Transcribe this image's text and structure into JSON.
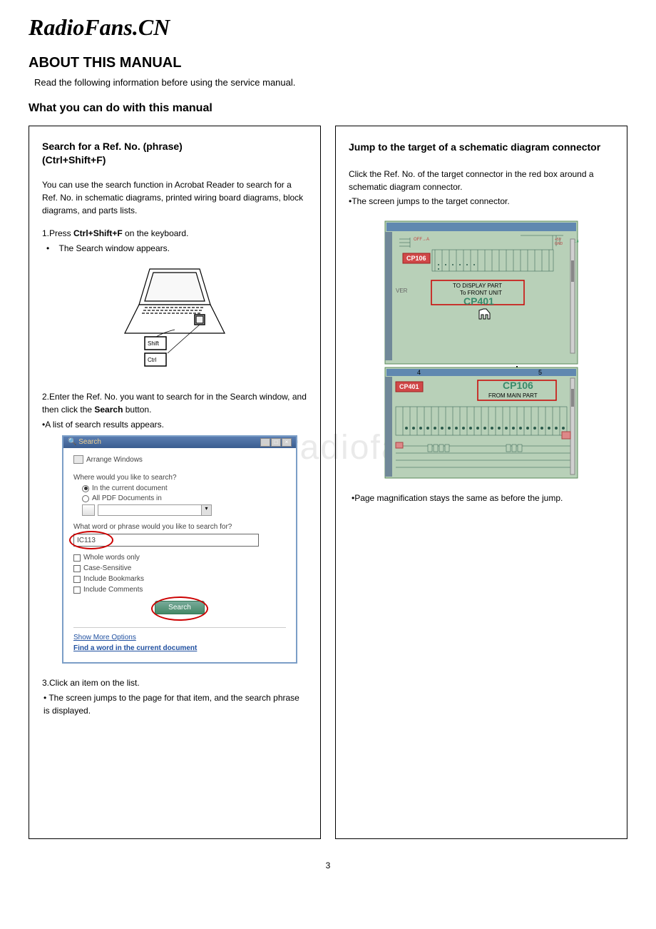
{
  "watermark": "RadioFans.CN",
  "bg_watermark": "www.radiofans.cn",
  "main_title": "ABOUT THIS MANUAL",
  "intro": "Read the following information before using the service manual.",
  "sub_heading": "What you can do with this manual",
  "left": {
    "title": "Search for a Ref. No. (phrase)",
    "subtitle": "(Ctrl+Shift+F)",
    "para1": "You can use the search function in Acrobat Reader to search for a Ref. No. in schematic diagrams, printed wiring board diagrams, block diagrams, and parts lists.",
    "step1_a": "1.Press ",
    "step1_b": "Ctrl+Shift+F",
    "step1_c": " on the keyboard.",
    "bullet1": "The Search window appears.",
    "key_shift": "Shift",
    "key_ctrl": "Ctrl",
    "step2_a": "2.Enter the Ref. No. you want to search for in the Search window, and then click the ",
    "step2_b": "Search",
    "step2_c": " button.",
    "bullet2": "•A list of search results appears.",
    "dialog": {
      "title": "Search",
      "arrange": "Arrange Windows",
      "q1": "Where would you like to search?",
      "r1": "In the current document",
      "r2": "All PDF Documents in",
      "q2": "What word or phrase would you like to search for?",
      "input_val": "IC113",
      "cb1": "Whole words only",
      "cb2": "Case-Sensitive",
      "cb3": "Include Bookmarks",
      "cb4": "Include Comments",
      "btn": "Search",
      "link1": "Show More Options",
      "link2": "Find a word in the current document"
    },
    "step3": "3.Click an item on the list.",
    "bullet3": "• The screen jumps to the page for that item, and the search phrase is displayed."
  },
  "right": {
    "title": "Jump to the target of a schematic diagram connector",
    "para1": "Click the Ref. No. of the target connector in the red box around a schematic diagram connector.",
    "bullet1": "•The screen jumps to the target connector.",
    "labels": {
      "cp106": "CP106",
      "display": "TO DISPLAY PART",
      "front": "To FRONT UNIT",
      "cp401_green": "CP401",
      "ver": "VER",
      "n4": "4",
      "n5": "5",
      "cp401": "CP401",
      "cp106_green": "CP106",
      "from": "FROM MAIN PART"
    },
    "note": "•Page magnification stays the same as before the jump."
  },
  "page_num": "3"
}
